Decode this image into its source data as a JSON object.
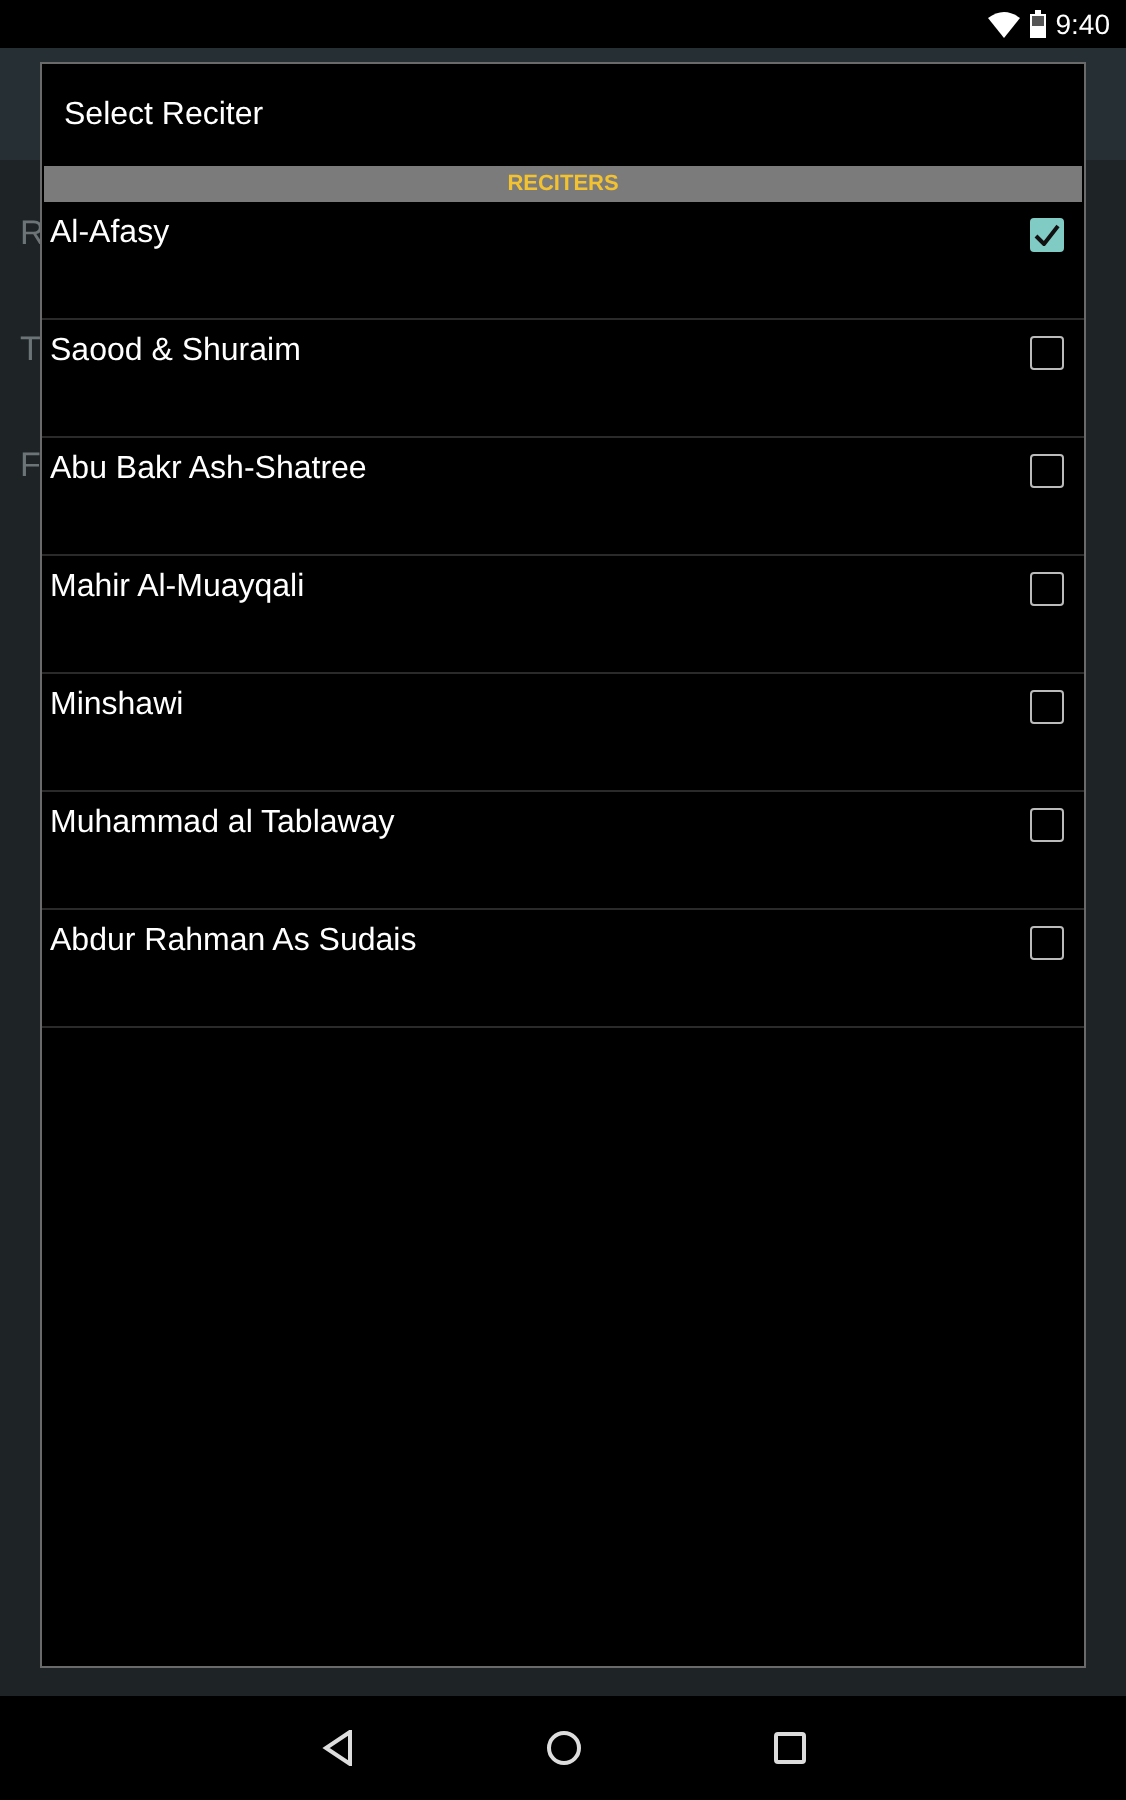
{
  "status_bar": {
    "time": "9:40"
  },
  "background_labels": [
    "R",
    "T",
    "F"
  ],
  "dialog": {
    "title": "Select Reciter",
    "section": "RECITERS",
    "items": [
      {
        "label": "Al-Afasy",
        "checked": true
      },
      {
        "label": "Saood & Shuraim",
        "checked": false
      },
      {
        "label": "Abu Bakr Ash-Shatree",
        "checked": false
      },
      {
        "label": "Mahir Al-Muayqali",
        "checked": false
      },
      {
        "label": "Minshawi",
        "checked": false
      },
      {
        "label": "Muhammad al Tablaway",
        "checked": false
      },
      {
        "label": "Abdur Rahman As Sudais",
        "checked": false
      }
    ]
  }
}
